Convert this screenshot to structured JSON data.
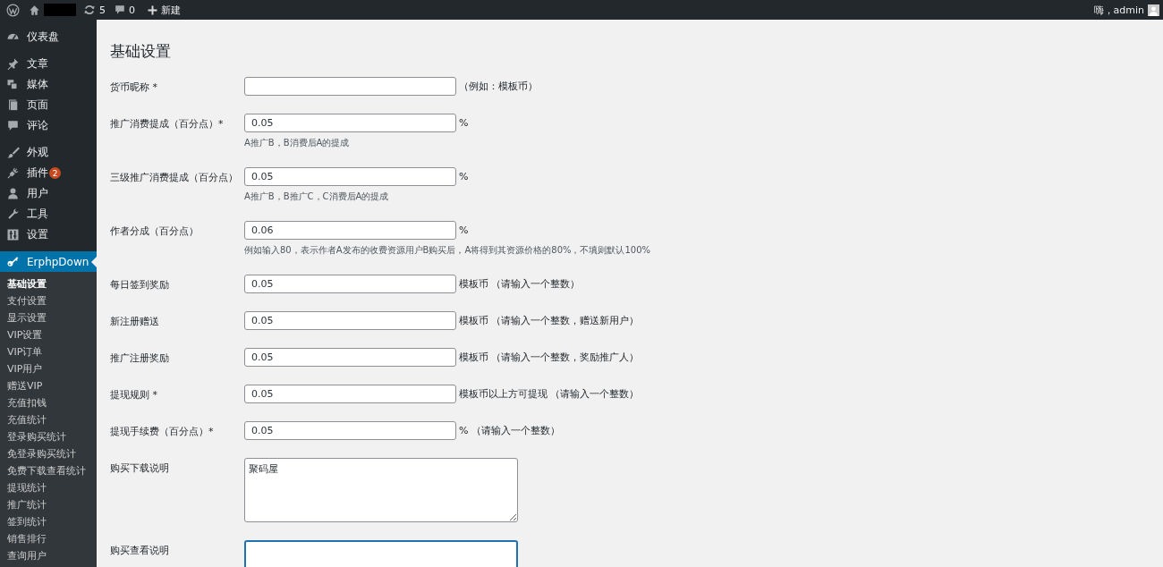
{
  "admin_bar": {
    "updates": "5",
    "comments": "0",
    "new_label": "新建",
    "greeting": "嗨，admin"
  },
  "sidebar": {
    "groups": [
      {
        "items": [
          {
            "label": "仪表盘",
            "selected": false
          }
        ]
      },
      {
        "items": [
          {
            "label": "文章",
            "selected": false
          },
          {
            "label": "媒体",
            "selected": false
          },
          {
            "label": "页面",
            "selected": false
          },
          {
            "label": "评论",
            "selected": false
          }
        ]
      },
      {
        "items": [
          {
            "label": "外观",
            "selected": false
          },
          {
            "label": "插件",
            "selected": false,
            "badge": "2"
          },
          {
            "label": "用户",
            "selected": false
          },
          {
            "label": "工具",
            "selected": false
          },
          {
            "label": "设置",
            "selected": false
          }
        ]
      },
      {
        "items": [
          {
            "label": "ErphpDown",
            "selected": true
          }
        ]
      }
    ],
    "submenu": [
      {
        "label": "基础设置",
        "selected": true
      },
      {
        "label": "支付设置",
        "selected": false
      },
      {
        "label": "显示设置",
        "selected": false
      },
      {
        "label": "VIP设置",
        "selected": false
      },
      {
        "label": "VIP订单",
        "selected": false
      },
      {
        "label": "VIP用户",
        "selected": false
      },
      {
        "label": "赠送VIP",
        "selected": false
      },
      {
        "label": "充值扣钱",
        "selected": false
      },
      {
        "label": "充值统计",
        "selected": false
      },
      {
        "label": "登录购买统计",
        "selected": false
      },
      {
        "label": "免登录购买统计",
        "selected": false
      },
      {
        "label": "免费下载查看统计",
        "selected": false
      },
      {
        "label": "提现统计",
        "selected": false
      },
      {
        "label": "推广统计",
        "selected": false
      },
      {
        "label": "签到统计",
        "selected": false
      },
      {
        "label": "销售排行",
        "selected": false
      },
      {
        "label": "查询用户",
        "selected": false
      }
    ]
  },
  "page": {
    "title": "基础设置"
  },
  "form": {
    "fields": [
      {
        "kind": "text",
        "label": "货币昵称 *",
        "suffix": "（例如：模板币）",
        "focused": false
      },
      {
        "kind": "text",
        "label": "推广消费提成（百分点）*",
        "value": "0.05",
        "suffix": "%",
        "description": "A推广B，B消费后A的提成",
        "focused": false
      },
      {
        "kind": "text",
        "label": "三级推广消费提成（百分点）",
        "value": "0.05",
        "suffix": "%",
        "description": "A推广B，B推广C，C消费后A的提成",
        "focused": false
      },
      {
        "kind": "text",
        "label": "作者分成（百分点）",
        "value": "0.06",
        "suffix": "%",
        "description": "例如输入80，表示作者A发布的收费资源用户B购买后，A将得到其资源价格的80%，不填则默认100%",
        "focused": false
      },
      {
        "kind": "text",
        "label": "每日签到奖励",
        "value": "0.05",
        "suffix": "模板币 （请输入一个整数）",
        "focused": false
      },
      {
        "kind": "text",
        "label": "新注册赠送",
        "value": "0.05",
        "suffix": "模板币 （请输入一个整数，赠送新用户）",
        "focused": false
      },
      {
        "kind": "text",
        "label": "推广注册奖励",
        "value": "0.05",
        "suffix": "模板币 （请输入一个整数，奖励推广人）",
        "focused": false
      },
      {
        "kind": "text",
        "label": "提现规则 *",
        "value": "0.05",
        "suffix": "模板币以上方可提现 （请输入一个整数）",
        "focused": false
      },
      {
        "kind": "text",
        "label": "提现手续费（百分点）*",
        "value": "0.05",
        "suffix": "% （请输入一个整数）",
        "focused": false
      },
      {
        "kind": "textarea",
        "label": "购买下载说明",
        "value": "聚码屋",
        "focused": false
      },
      {
        "kind": "textarea",
        "label": "购买查看说明",
        "focused": true
      }
    ]
  }
}
